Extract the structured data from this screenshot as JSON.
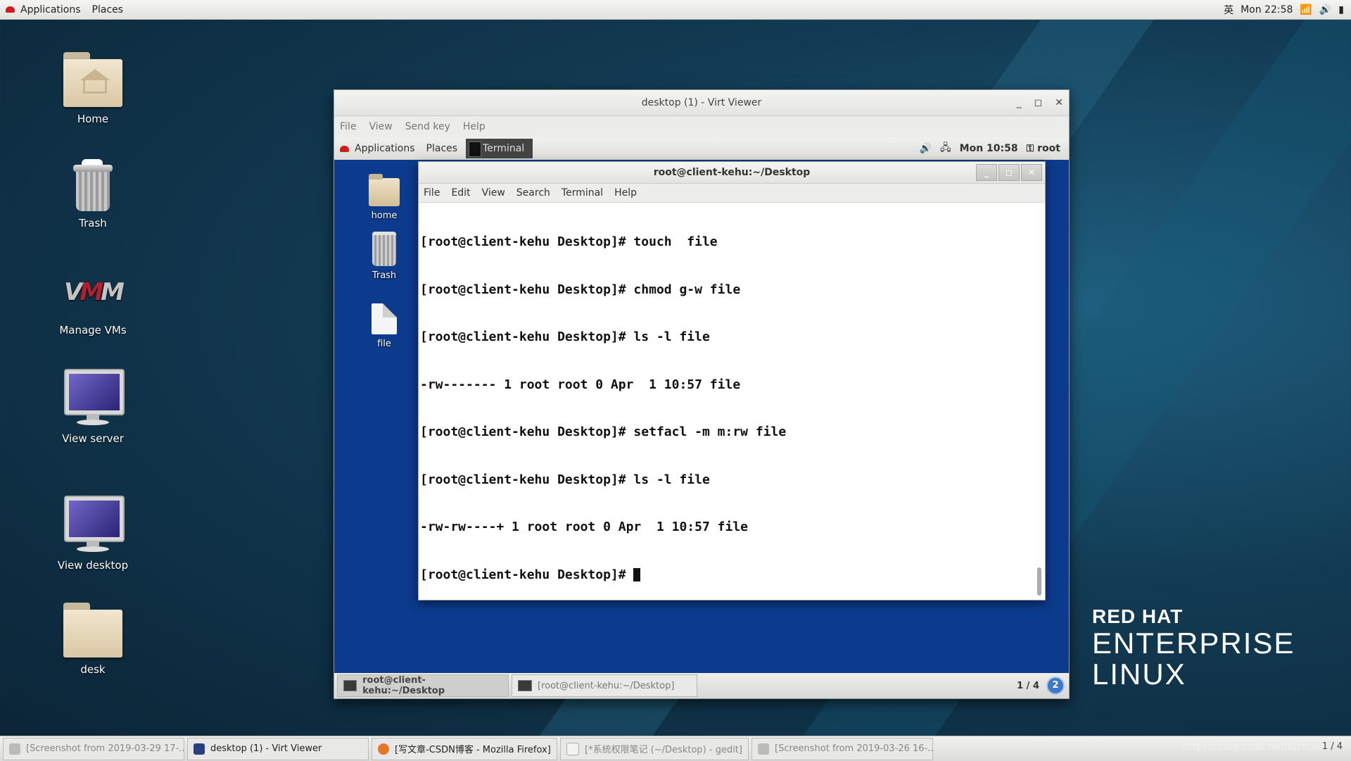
{
  "topbar": {
    "applications": "Applications",
    "places": "Places",
    "ime": "英",
    "clock": "Mon 22:58"
  },
  "desktop_icons": [
    {
      "label": "Home"
    },
    {
      "label": "Trash"
    },
    {
      "label": "Manage VMs"
    },
    {
      "label": "View server"
    },
    {
      "label": "View desktop"
    },
    {
      "label": "desk"
    }
  ],
  "rh_logo": {
    "line1": "RED HAT",
    "line2": "ENTERPRISE",
    "line3": "LINUX"
  },
  "virt_viewer": {
    "title": "desktop (1) - Virt Viewer",
    "menu": [
      "File",
      "View",
      "Send key",
      "Help"
    ],
    "guest": {
      "topbar": {
        "applications": "Applications",
        "places": "Places",
        "terminal": "Terminal",
        "clock": "Mon 10:58",
        "user": "root"
      },
      "icons": [
        {
          "label": "home"
        },
        {
          "label": "Trash"
        },
        {
          "label": "file"
        }
      ],
      "terminal": {
        "title": "root@client-kehu:~/Desktop",
        "menu": [
          "File",
          "Edit",
          "View",
          "Search",
          "Terminal",
          "Help"
        ],
        "lines": [
          "[root@client-kehu Desktop]# touch  file",
          "[root@client-kehu Desktop]# chmod g-w file",
          "[root@client-kehu Desktop]# ls -l file",
          "-rw------- 1 root root 0 Apr  1 10:57 file",
          "[root@client-kehu Desktop]# setfacl -m m:rw file",
          "[root@client-kehu Desktop]# ls -l file",
          "-rw-rw----+ 1 root root 0 Apr  1 10:57 file",
          "[root@client-kehu Desktop]# "
        ]
      },
      "taskbar": {
        "tasks": [
          "root@client-kehu:~/Desktop",
          "[root@client-kehu:~/Desktop]"
        ],
        "pager": "1 / 4",
        "help": "2"
      }
    }
  },
  "taskbar": {
    "tasks": [
      "[Screenshot from 2019-03-29 17-...",
      "desktop (1) - Virt Viewer",
      "[写文章-CSDN博客 - Mozilla Firefox]",
      "[*系统权限笔记 (~/Desktop) - gedit]",
      "[Screenshot from 2019-03-26 16-..."
    ],
    "watermark": "https://blog.csdn.net/luchuar...",
    "pager": "1 / 4"
  }
}
